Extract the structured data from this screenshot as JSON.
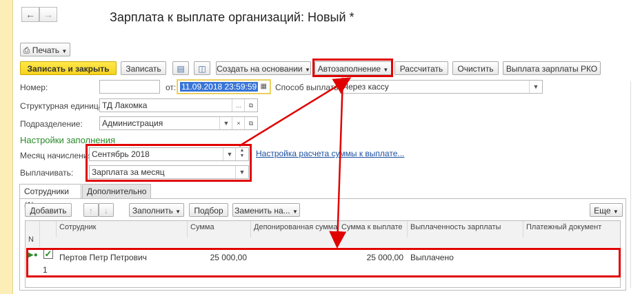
{
  "window": {
    "title": "Зарплата к выплате организаций: Новый *"
  },
  "toolbar1": {
    "print_label": "Печать"
  },
  "toolbar2": {
    "save_close": "Записать и закрыть",
    "save": "Записать",
    "create_based": "Создать на основании",
    "autofill": "Автозаполнение",
    "calculate": "Рассчитать",
    "clear": "Очистить",
    "pay_rko": "Выплата зарплаты РКО"
  },
  "form": {
    "number_label": "Номер:",
    "number_value": "",
    "date_label": "от:",
    "date_value": "11.09.2018 23:59:59",
    "payment_method_label": "Способ выплаты:",
    "payment_method_value": "Через кассу",
    "unit_label": "Структурная единица:",
    "unit_value": "ТД Лакомка",
    "dept_label": "Подразделение:",
    "dept_value": "Администрация",
    "fill_settings": "Настройки заполнения",
    "month_label": "Месяц начисления:",
    "month_value": "Сентябрь 2018",
    "pay_label": "Выплачивать:",
    "pay_value": "Зарплата за месяц",
    "settings_link": "Настройка расчета суммы к выплате..."
  },
  "tabs": [
    {
      "label": "Сотрудники (1)"
    },
    {
      "label": "Дополнительно"
    }
  ],
  "table_toolbar": {
    "add": "Добавить",
    "fill": "Заполнить",
    "select": "Подбор",
    "replace": "Заменить на...",
    "more": "Еще"
  },
  "table": {
    "columns": [
      "N",
      "Сотрудник",
      "Сумма",
      "Депонированная сумма",
      "Сумма к выплате",
      "Выплаченность зарплаты",
      "Платежный документ"
    ],
    "rows": [
      {
        "n": "1",
        "employee": "Пертов Петр Петрович",
        "sum": "25 000,00",
        "deposited": "",
        "to_pay": "25 000,00",
        "status": "Выплачено",
        "doc": ""
      }
    ]
  },
  "colors": {
    "highlight": "#e00000",
    "accent_button": "#f5d21e",
    "selection": "#3875d7"
  }
}
